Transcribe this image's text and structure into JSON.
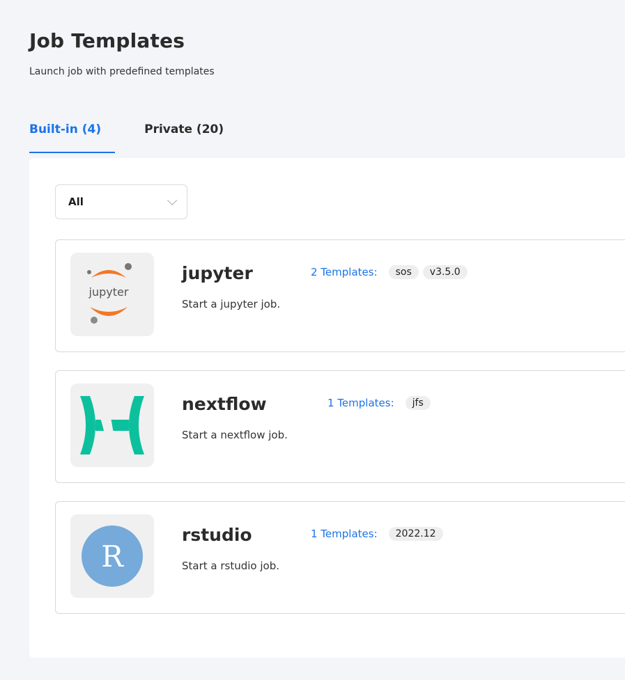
{
  "header": {
    "title": "Job Templates",
    "subtitle": "Launch job with predefined templates"
  },
  "tabs": [
    {
      "label": "Built-in (4)",
      "active": true
    },
    {
      "label": "Private (20)",
      "active": false
    }
  ],
  "filter": {
    "selected": "All"
  },
  "cards": [
    {
      "name": "jupyter",
      "templates_label": "2 Templates:",
      "tags": [
        "sos",
        "v3.5.0"
      ],
      "description": "Start a jupyter job.",
      "icon": "jupyter-logo"
    },
    {
      "name": "nextflow",
      "templates_label": "1 Templates:",
      "tags": [
        "jfs"
      ],
      "description": "Start a nextflow job.",
      "icon": "nextflow-logo"
    },
    {
      "name": "rstudio",
      "templates_label": "1 Templates:",
      "tags": [
        "2022.12"
      ],
      "description": "Start a rstudio job.",
      "icon": "rstudio-logo"
    }
  ],
  "logos": {
    "jupyter_text": "jupyter",
    "rstudio_letter": "R"
  },
  "colors": {
    "accent": "#1a73e8",
    "jupyter_orange": "#f37726",
    "nextflow_green": "#0dc09d",
    "rstudio_blue": "#75aadb"
  }
}
